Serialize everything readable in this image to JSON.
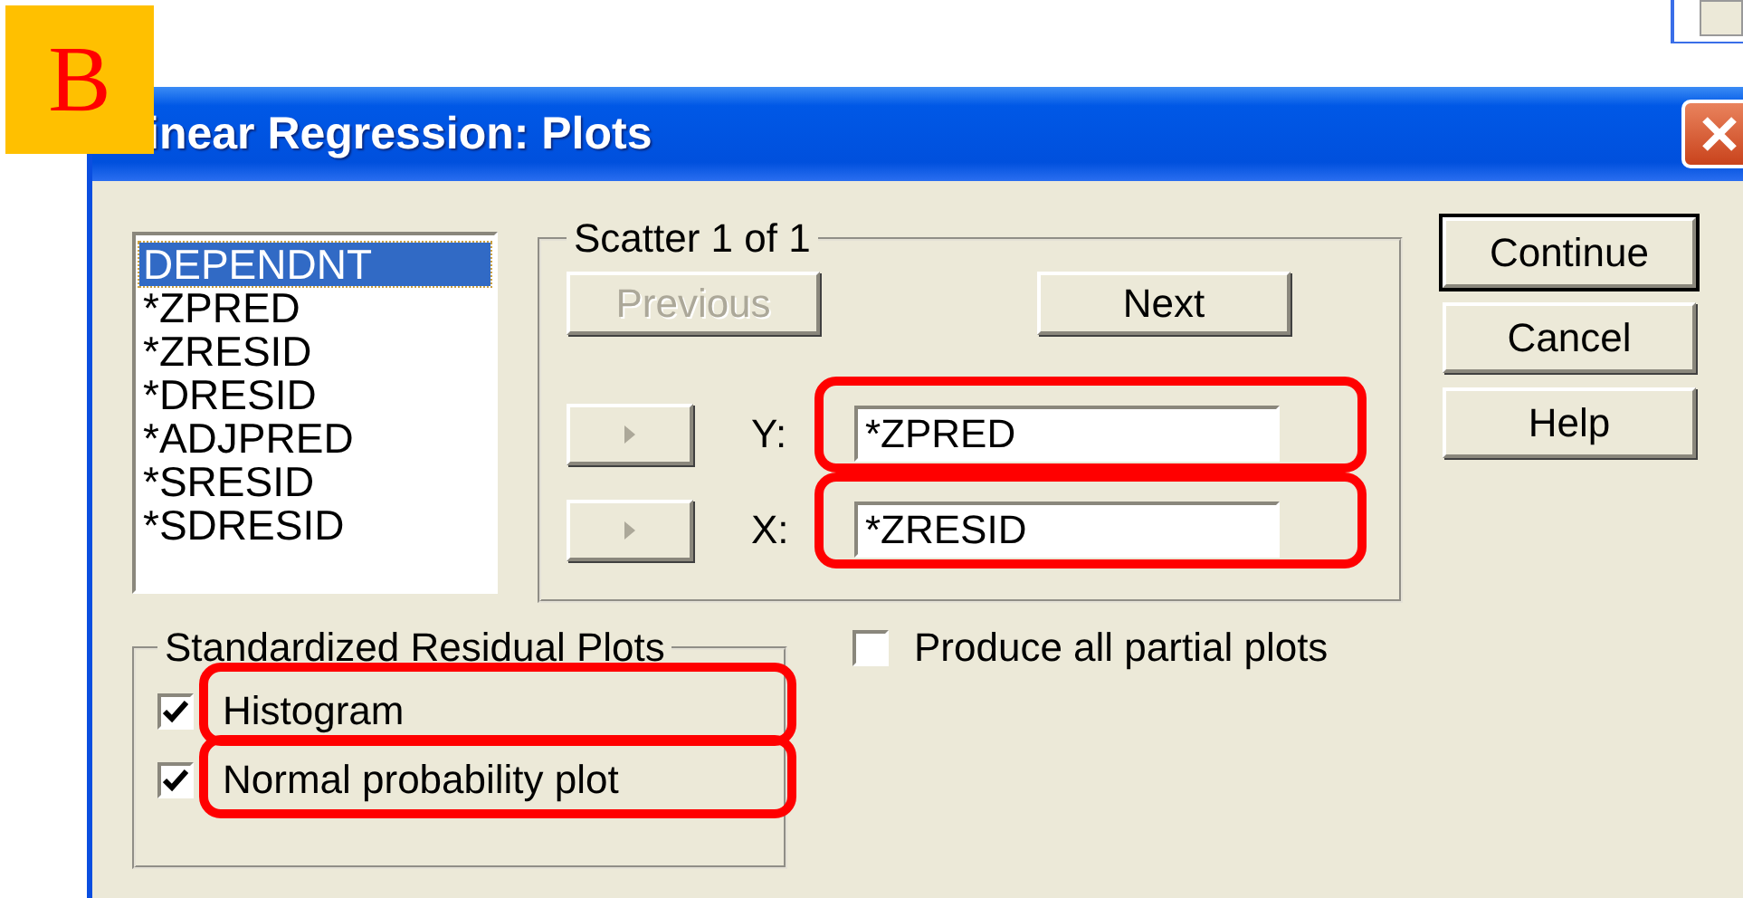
{
  "badge": {
    "label": "B"
  },
  "window": {
    "title": "inear Regression: Plots"
  },
  "variables": [
    {
      "label": "DEPENDNT",
      "selected": true
    },
    {
      "label": "*ZPRED",
      "selected": false
    },
    {
      "label": "*ZRESID",
      "selected": false
    },
    {
      "label": "*DRESID",
      "selected": false
    },
    {
      "label": "*ADJPRED",
      "selected": false
    },
    {
      "label": "*SRESID",
      "selected": false
    },
    {
      "label": "*SDRESID",
      "selected": false
    }
  ],
  "scatter": {
    "title": "Scatter 1 of 1",
    "nav_buttons": [
      {
        "label": "Previous",
        "disabled": true
      },
      {
        "label": "Next",
        "disabled": false
      }
    ],
    "axes": [
      {
        "label": "Y:",
        "value": "*ZPRED",
        "highlighted": true
      },
      {
        "label": "X:",
        "value": "*ZRESID",
        "highlighted": true
      }
    ]
  },
  "buttons": [
    {
      "label": "Continue",
      "default": true
    },
    {
      "label": "Cancel",
      "default": false
    },
    {
      "label": "Help",
      "default": false
    }
  ],
  "residual_plots": {
    "title": "Standardized Residual Plots",
    "options": [
      {
        "label": "Histogram",
        "checked": true,
        "highlighted": true
      },
      {
        "label": "Normal probability plot",
        "checked": true,
        "highlighted": true
      }
    ]
  },
  "partial_plots": {
    "label": "Produce all partial plots",
    "checked": false
  }
}
